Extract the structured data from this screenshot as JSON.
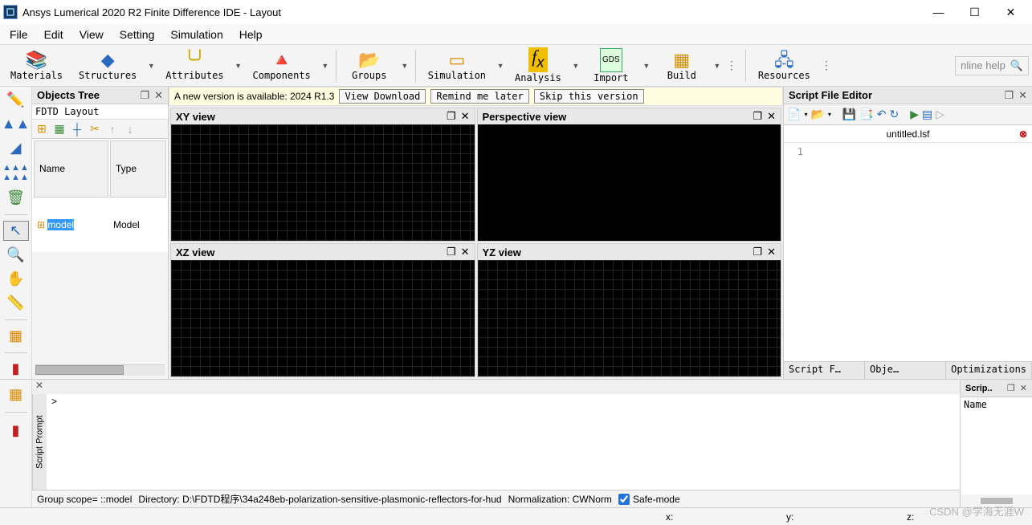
{
  "title": "Ansys Lumerical 2020 R2 Finite Difference IDE - Layout",
  "menu": [
    "File",
    "Edit",
    "View",
    "Setting",
    "Simulation",
    "Help"
  ],
  "toolbar": [
    {
      "label": "Materials",
      "icon": "📚",
      "arrow": false
    },
    {
      "label": "Structures",
      "icon": "🔷",
      "arrow": true
    },
    {
      "label": "Attributes",
      "icon": "〰️",
      "arrow": true
    },
    {
      "label": "Components",
      "icon": "🔺",
      "arrow": true
    },
    {
      "label": "Groups",
      "icon": "📂",
      "arrow": true
    },
    {
      "label": "Simulation",
      "icon": "▭",
      "arrow": true
    },
    {
      "label": "Analysis",
      "icon": "fx",
      "arrow": true
    },
    {
      "label": "Import",
      "icon": "GDS",
      "arrow": true
    },
    {
      "label": "Build",
      "icon": "▦",
      "arrow": true
    }
  ],
  "resources_label": "Resources",
  "help_placeholder": "nline help",
  "objects_tree": {
    "title": "Objects Tree",
    "subtitle": "FDTD Layout",
    "columns": [
      "Name",
      "Type"
    ],
    "row": {
      "name": "model",
      "type": "Model"
    }
  },
  "banner": {
    "text": "A new version is available: 2024 R1.3",
    "buttons": [
      "View Download",
      "Remind me later",
      "Skip this version"
    ]
  },
  "views": [
    "XY view",
    "Perspective view",
    "XZ view",
    "YZ view"
  ],
  "script_editor": {
    "title": "Script File Editor",
    "filename": "untitled.lsf",
    "line": "1",
    "tabs": [
      "Script F…",
      "Obje…",
      "Optimizations …"
    ]
  },
  "console": {
    "label": "Script Prompt",
    "prompt": ">"
  },
  "side_panel": {
    "title": "Scrip..",
    "column": "Name"
  },
  "status": {
    "scope": "Group scope= ::model",
    "dir": "Directory: D:\\FDTD程序\\34a248eb-polarization-sensitive-plasmonic-reflectors-for-hud",
    "norm": "Normalization: CWNorm",
    "safe": "Safe-mode"
  },
  "coords": {
    "x": "x:",
    "y": "y:",
    "z": "z:"
  },
  "watermark": "CSDN @学海无涯W"
}
